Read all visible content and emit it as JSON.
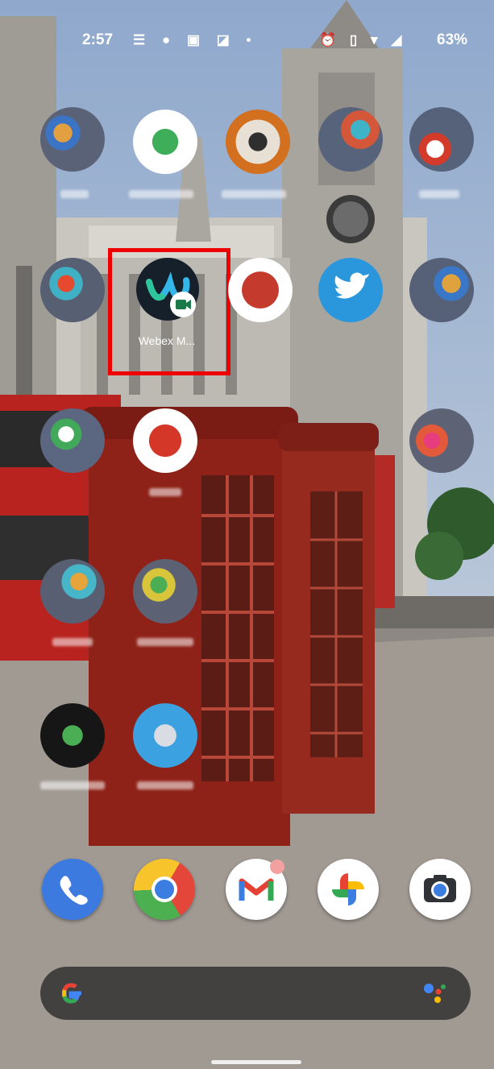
{
  "status_bar": {
    "time": "2:57",
    "left_icons": "☰ ● ▣ ◪ •",
    "right_icons": "⏰ ▯ ▾ ◢",
    "battery": "63%"
  },
  "highlighted_app": {
    "label": "Webex M..."
  },
  "dock": {
    "apps": [
      "Phone",
      "Chrome",
      "Gmail",
      "Photos",
      "Camera"
    ]
  },
  "search_bar": {
    "logo": "G"
  }
}
